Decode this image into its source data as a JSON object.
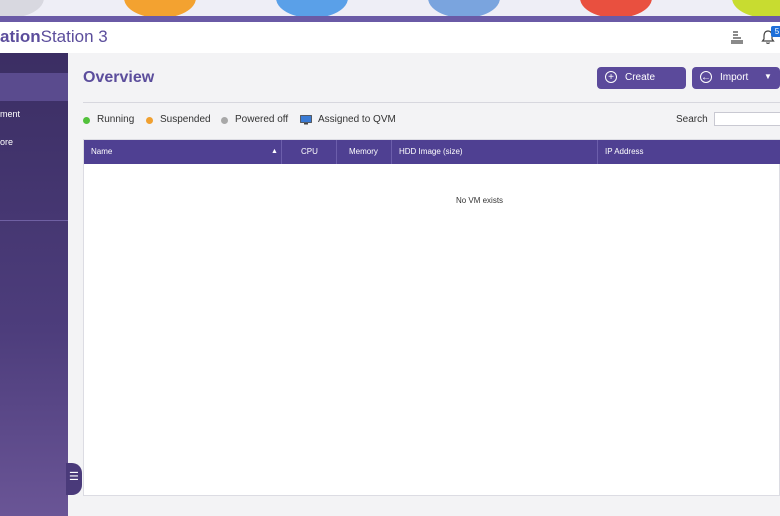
{
  "header": {
    "app_title_bold": "ation",
    "app_title_rest": "Station 3",
    "notification_count": "5"
  },
  "sidebar": {
    "items": [
      {
        "label": ""
      },
      {
        "label": "ment"
      },
      {
        "label": "ore"
      }
    ]
  },
  "main": {
    "title": "Overview",
    "create_label": "Create",
    "import_label": "Import",
    "legend": [
      "Running",
      "Suspended",
      "Powered off",
      "Assigned to QVM"
    ],
    "search_label": "Search",
    "search_value": ""
  },
  "table": {
    "columns": [
      "Name",
      "CPU",
      "Memory",
      "HDD Image (size)",
      "IP Address"
    ],
    "empty_text": "No VM exists"
  },
  "colors": {
    "accent": "#5b4d9c",
    "running": "#52c13b",
    "suspended": "#f0a030",
    "powered_off": "#a8a8a8"
  }
}
